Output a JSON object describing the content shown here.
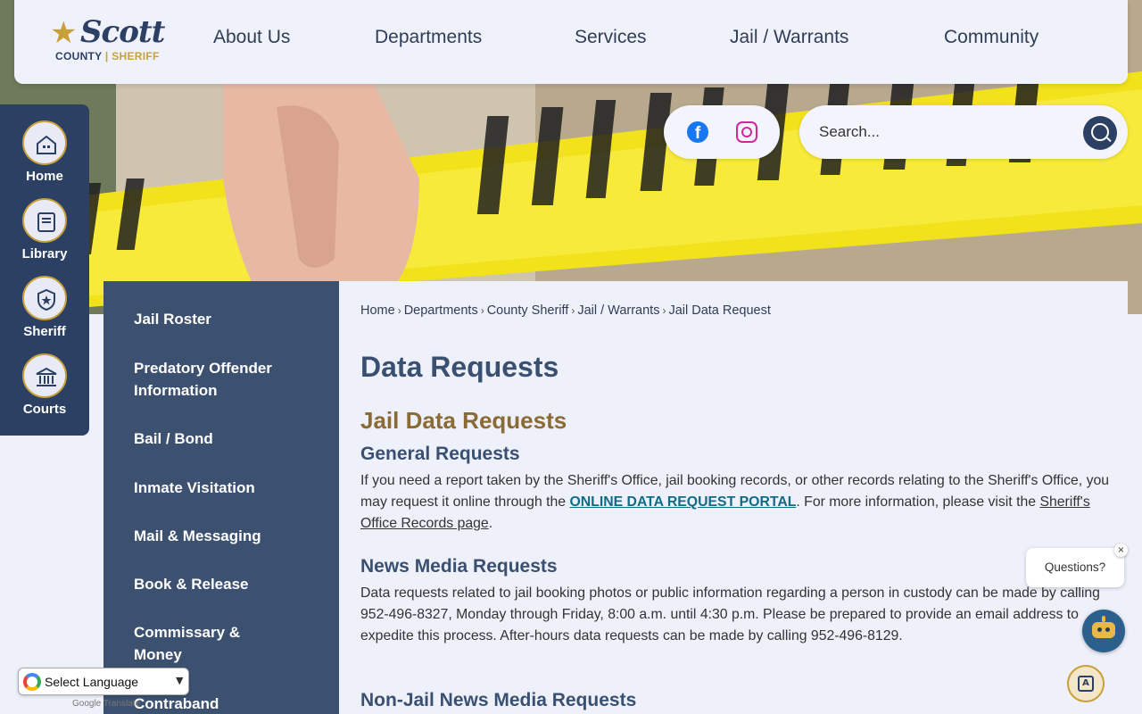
{
  "logo": {
    "name": "Scott",
    "line1": "COUNTY",
    "line2": "SHERIFF"
  },
  "nav": {
    "items": [
      "About Us",
      "Departments",
      "Services",
      "Jail / Warrants",
      "Community"
    ]
  },
  "social": {
    "facebook_icon": "facebook-icon",
    "instagram_icon": "instagram-icon"
  },
  "search": {
    "placeholder": "Search..."
  },
  "rail": {
    "items": [
      {
        "label": "Home",
        "icon": "home-icon"
      },
      {
        "label": "Library",
        "icon": "book-icon"
      },
      {
        "label": "Sheriff",
        "icon": "badge-icon"
      },
      {
        "label": "Courts",
        "icon": "courthouse-icon"
      }
    ]
  },
  "submenu": {
    "items": [
      "Jail Roster",
      "Predatory Offender Information",
      "Bail / Bond",
      "Inmate Visitation",
      "Mail & Messaging",
      "Book & Release",
      "Commissary & Money",
      "Contraband"
    ]
  },
  "breadcrumb": [
    "Home",
    "Departments",
    "County Sheriff",
    "Jail / Warrants",
    "Jail Data Request"
  ],
  "page": {
    "title": "Data Requests",
    "section_title": "Jail Data Requests",
    "general": {
      "heading": "General Requests",
      "text_1": "If you need a report taken by the Sheriff's Office, jail booking records, or other records relating to the Sheriff's Office, you may request it online through the ",
      "portal_link": "ONLINE DATA REQUEST PORTAL",
      "text_2": ". For more information, please visit the ",
      "records_link": "Sheriff's Office Records page",
      "text_3": "."
    },
    "news": {
      "heading": "News Media Requests",
      "text": "Data requests related to jail booking photos or public information regarding a person in custody can be made by calling 952-496-8327, Monday through Friday, 8:00 a.m. until 4:30 p.m. Please be prepared to provide an email address to expedite this process.  After-hours data requests can be made by calling 952-496-8129."
    },
    "nonjail": {
      "heading": "Non-Jail News Media Requests"
    }
  },
  "widgets": {
    "questions": "Questions?",
    "close": "×"
  },
  "translate": {
    "label": "Select Language",
    "powered": "Translate",
    "google": "Google"
  }
}
